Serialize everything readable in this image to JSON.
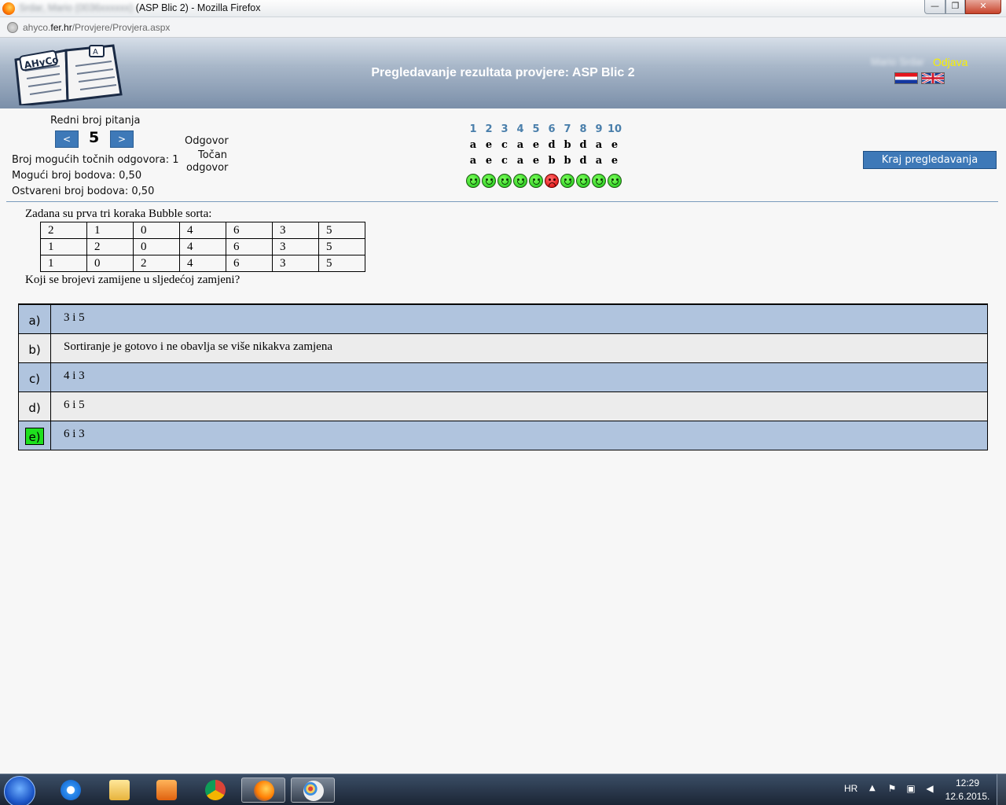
{
  "window": {
    "title_blurred": "Srdar, Mario (0036xxxxxx)",
    "title_rest": "(ASP Blic 2) - Mozilla Firefox",
    "min_glyph": "—",
    "max_glyph": "❐",
    "close_glyph": "✕"
  },
  "browser": {
    "url_prefix": "ahyco.",
    "url_domain": "fer.hr",
    "url_path": "/Provjere/Provjera.aspx"
  },
  "header": {
    "logo_text": "AHyCo",
    "logo_tab": "A",
    "title": "Pregledavanje rezultata provjere: ASP Blic 2",
    "user_name": "Mario Srdar",
    "logout": "Odjava"
  },
  "info": {
    "question_label": "Redni broj pitanja",
    "prev": "<",
    "next": ">",
    "current_question": "5",
    "possible_correct": "Broj mogućih točnih odgovora: 1",
    "possible_points": "Mogući broj bodova: 0,50",
    "achieved_points": "Ostvareni broj bodova: 0,50",
    "answer_label": "Odgovor",
    "correct_label_1": "Točan",
    "correct_label_2": "odgovor",
    "end_button": "Kraj pregledavanja"
  },
  "summary": {
    "numbers": [
      "1",
      "2",
      "3",
      "4",
      "5",
      "6",
      "7",
      "8",
      "9",
      "10"
    ],
    "given": [
      "a",
      "e",
      "c",
      "a",
      "e",
      "d",
      "b",
      "d",
      "a",
      "e"
    ],
    "correct": [
      "a",
      "e",
      "c",
      "a",
      "e",
      "b",
      "b",
      "d",
      "a",
      "e"
    ],
    "status": [
      "ok",
      "ok",
      "ok",
      "ok",
      "ok",
      "bad",
      "ok",
      "ok",
      "ok",
      "ok"
    ]
  },
  "question": {
    "intro": "Zadana su prva tri koraka Bubble sorta:",
    "steps": [
      [
        "2",
        "1",
        "0",
        "4",
        "6",
        "3",
        "5"
      ],
      [
        "1",
        "2",
        "0",
        "4",
        "6",
        "3",
        "5"
      ],
      [
        "1",
        "0",
        "2",
        "4",
        "6",
        "3",
        "5"
      ]
    ],
    "text": "Koji se brojevi zamijene u sljedećoj zamjeni?"
  },
  "answers": [
    {
      "letter": "a)",
      "text": "3 i 5",
      "marked": false
    },
    {
      "letter": "b)",
      "text": "Sortiranje je gotovo i ne obavlja se više nikakva zamjena",
      "marked": false
    },
    {
      "letter": "c)",
      "text": "4 i 3",
      "marked": false
    },
    {
      "letter": "d)",
      "text": "6 i 5",
      "marked": false
    },
    {
      "letter": "e)",
      "text": "6 i 3",
      "marked": true
    }
  ],
  "taskbar": {
    "lang": "HR",
    "time": "12:29",
    "date": "12.6.2015."
  }
}
